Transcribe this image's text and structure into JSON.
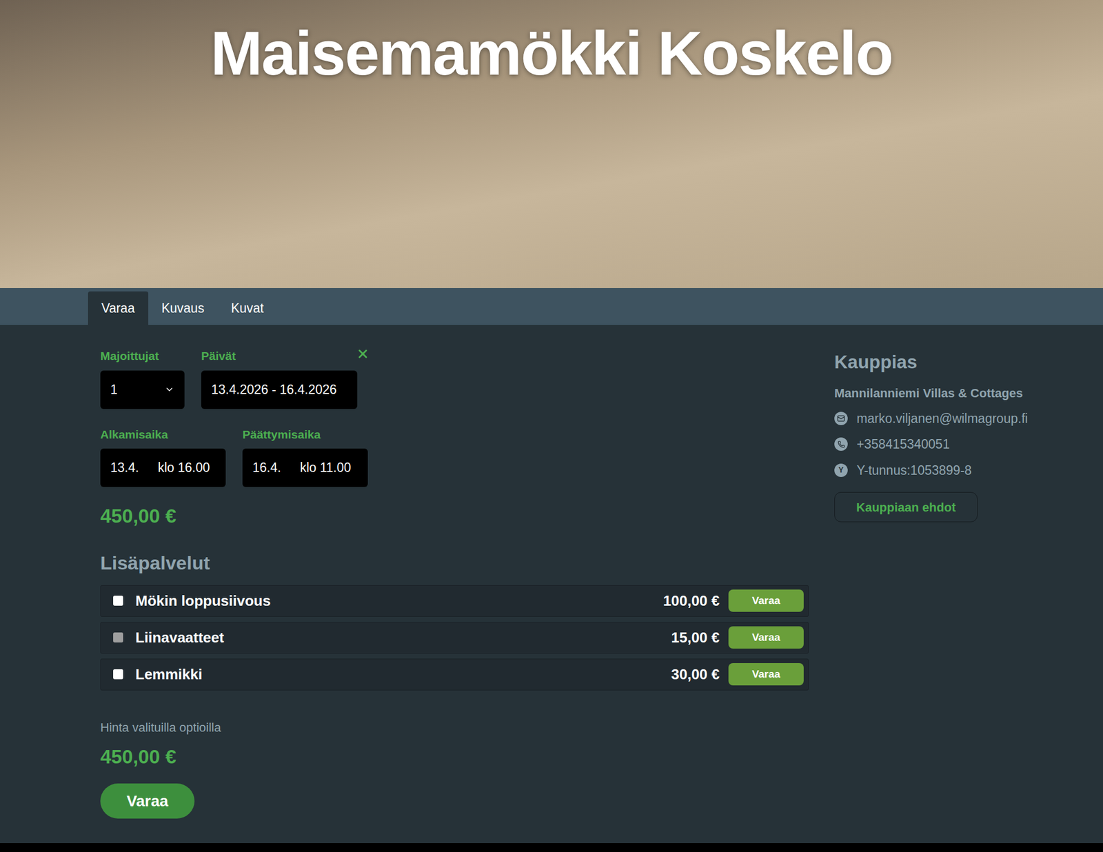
{
  "hero": {
    "title": "Maisemamökki Koskelo"
  },
  "tabs": [
    {
      "label": "Varaa",
      "selected": true
    },
    {
      "label": "Kuvaus",
      "selected": false
    },
    {
      "label": "Kuvat",
      "selected": false
    }
  ],
  "booking": {
    "guests": {
      "label": "Majoittujat",
      "value": "1"
    },
    "dates": {
      "label": "Päivät",
      "value": "13.4.2026 - 16.4.2026"
    },
    "start": {
      "label": "Alkamisaika",
      "date": "13.4.",
      "time": "klo 16.00"
    },
    "end": {
      "label": "Päättymisaika",
      "date": "16.4.",
      "time": "klo 11.00"
    },
    "price": "450,00 €"
  },
  "extras": {
    "title": "Lisäpalvelut",
    "items": [
      {
        "name": "Mökin loppusiivous",
        "price": "100,00 €",
        "button": "Varaa",
        "checked": false,
        "disabled": false
      },
      {
        "name": "Liinavaatteet",
        "price": "15,00 €",
        "button": "Varaa",
        "checked": false,
        "disabled": true
      },
      {
        "name": "Lemmikki",
        "price": "30,00 €",
        "button": "Varaa",
        "checked": false,
        "disabled": false
      }
    ]
  },
  "total": {
    "label": "Hinta valituilla optioilla",
    "price": "450,00 €"
  },
  "book_button": "Varaa",
  "merchant": {
    "title": "Kauppias",
    "name": "Mannilanniemi Villas & Cottages",
    "contacts": [
      {
        "kind": "email",
        "text": "marko.viljanen@wilmagroup.fi"
      },
      {
        "kind": "phone",
        "text": "+358415340051"
      },
      {
        "kind": "id",
        "text": "Y-tunnus:1053899-8",
        "icon_text": "Y"
      }
    ],
    "button": "Kauppiaan ehdot"
  }
}
